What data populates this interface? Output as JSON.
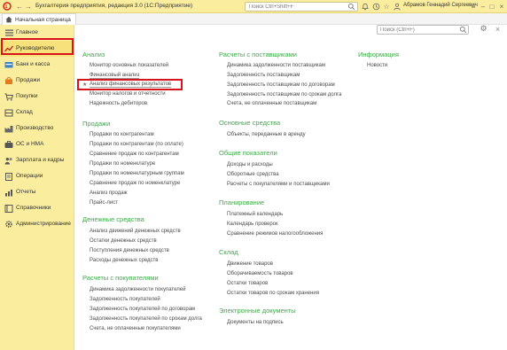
{
  "titlebar": {
    "app_title": "Бухгалтерия предприятия, редакция 3.0  (1С:Предприятие)",
    "search_placeholder": "Поиск Ctrl+Shift+F",
    "user_name": "Абрамов Геннадий Сергеевич"
  },
  "home_tab": {
    "label": "Начальная страница"
  },
  "sidebar": {
    "items": [
      {
        "label": "Главное",
        "icon": "menu-lines-icon"
      },
      {
        "label": "Руководителю",
        "icon": "trend-line-icon",
        "active": true
      },
      {
        "label": "Банк и касса",
        "icon": "bank-icon"
      },
      {
        "label": "Продажи",
        "icon": "sales-icon"
      },
      {
        "label": "Покупки",
        "icon": "cart-icon"
      },
      {
        "label": "Склад",
        "icon": "warehouse-icon"
      },
      {
        "label": "Производство",
        "icon": "production-icon"
      },
      {
        "label": "ОС и НМА",
        "icon": "assets-icon"
      },
      {
        "label": "Зарплата и кадры",
        "icon": "people-icon"
      },
      {
        "label": "Операции",
        "icon": "operations-icon"
      },
      {
        "label": "Отчеты",
        "icon": "reports-icon"
      },
      {
        "label": "Справочники",
        "icon": "catalog-icon"
      },
      {
        "label": "Администрирование",
        "icon": "gear-icon"
      }
    ]
  },
  "panel": {
    "search_placeholder": "Поиск (Ctrl+F)",
    "col1": [
      {
        "title": "Анализ",
        "links": [
          "Монитор основных показателей",
          "Финансовый анализ",
          "Анализ финансовых результатов",
          "Монитор налогов и отчетности",
          "Надежность дебиторов"
        ]
      },
      {
        "title": "Продажи",
        "links": [
          "Продажи по контрагентам",
          "Продажи по контрагентам (по оплате)",
          "Сравнение продаж по контрагентам",
          "Продажи по номенклатуре",
          "Продажи по номенклатурным группам",
          "Сравнение продаж по номенклатуре",
          "Анализ продаж",
          "Прайс-лист"
        ]
      },
      {
        "title": "Денежные средства",
        "links": [
          "Анализ движений денежных средств",
          "Остатки денежных средств",
          "Поступления денежных средств",
          "Расходы денежных средств"
        ]
      },
      {
        "title": "Расчеты с покупателями",
        "links": [
          "Динамика задолженности покупателей",
          "Задолженность покупателей",
          "Задолженность покупателей по договорам",
          "Задолженность покупателей по срокам долга",
          "Счета, не оплаченные покупателями"
        ]
      }
    ],
    "col2": [
      {
        "title": "Расчеты с поставщиками",
        "links": [
          "Динамика задолженности поставщикам",
          "Задолженность поставщикам",
          "Задолженность поставщикам по договорам",
          "Задолженность поставщикам по срокам долга",
          "Счета, не оплаченные поставщикам"
        ]
      },
      {
        "title": "Основные средства",
        "links": [
          "Объекты, переданные в аренду"
        ]
      },
      {
        "title": "Общие показатели",
        "links": [
          "Доходы и расходы",
          "Оборотные средства",
          "Расчеты с покупателями и поставщиками"
        ]
      },
      {
        "title": "Планирование",
        "links": [
          "Платежный календарь",
          "Календарь проверок",
          "Сравнение режимов налогообложения"
        ]
      },
      {
        "title": "Склад",
        "links": [
          "Движение товаров",
          "Оборачиваемость товаров",
          "Остатки товаров",
          "Остатки товаров по срокам хранения"
        ]
      },
      {
        "title": "Электронные документы",
        "links": [
          "Документы на подпись"
        ]
      }
    ],
    "col3": [
      {
        "title": "Информация",
        "links": [
          "Новости"
        ]
      }
    ]
  }
}
